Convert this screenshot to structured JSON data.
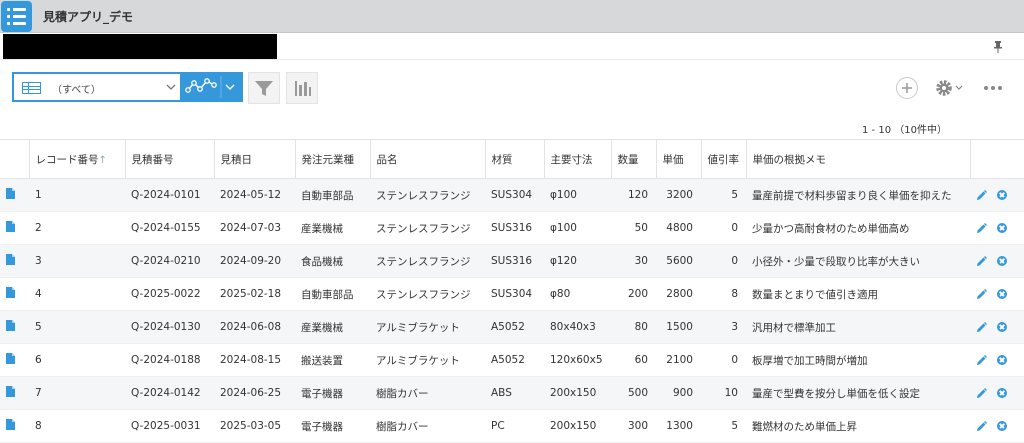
{
  "app": {
    "title": "見積アプリ_デモ"
  },
  "toolbar": {
    "view_label": "（すべて）",
    "pager_text": "1 - 10 （10件中）"
  },
  "table": {
    "columns": [
      "レコード番号",
      "見積番号",
      "見積日",
      "発注元業種",
      "品名",
      "材質",
      "主要寸法",
      "数量",
      "単価",
      "値引率",
      "単価の根拠メモ"
    ],
    "sort_indicator": "↑",
    "rows": [
      [
        "1",
        "Q-2024-0101",
        "2024-05-12",
        "自動車部品",
        "ステンレスフランジ",
        "SUS304",
        "φ100",
        "120",
        "3200",
        "5",
        "量産前提で材料歩留まり良く単価を抑えた"
      ],
      [
        "2",
        "Q-2024-0155",
        "2024-07-03",
        "産業機械",
        "ステンレスフランジ",
        "SUS316",
        "φ100",
        "50",
        "4800",
        "0",
        "少量かつ高耐食材のため単価高め"
      ],
      [
        "3",
        "Q-2024-0210",
        "2024-09-20",
        "食品機械",
        "ステンレスフランジ",
        "SUS316",
        "φ120",
        "30",
        "5600",
        "0",
        "小径外・少量で段取り比率が大きい"
      ],
      [
        "4",
        "Q-2025-0022",
        "2025-02-18",
        "自動車部品",
        "ステンレスフランジ",
        "SUS304",
        "φ80",
        "200",
        "2800",
        "8",
        "数量まとまりで値引き適用"
      ],
      [
        "5",
        "Q-2024-0130",
        "2024-06-08",
        "産業機械",
        "アルミブラケット",
        "A5052",
        "80x40x3",
        "80",
        "1500",
        "3",
        "汎用材で標準加工"
      ],
      [
        "6",
        "Q-2024-0188",
        "2024-08-15",
        "搬送装置",
        "アルミブラケット",
        "A5052",
        "120x60x5",
        "60",
        "2100",
        "0",
        "板厚増で加工時間が増加"
      ],
      [
        "7",
        "Q-2024-0142",
        "2024-06-25",
        "電子機器",
        "樹脂カバー",
        "ABS",
        "200x150",
        "500",
        "900",
        "10",
        "量産で型費を按分し単価を低く設定"
      ],
      [
        "8",
        "Q-2025-0031",
        "2025-03-05",
        "電子機器",
        "樹脂カバー",
        "PC",
        "200x150",
        "300",
        "1300",
        "5",
        "難燃材のため単価上昇"
      ]
    ]
  },
  "colors": {
    "accent": "#3498db",
    "header_bg": "#d6d8da",
    "row_alt": "#f5f6f7"
  },
  "icons": [
    "app-list-icon",
    "pin-icon",
    "table-icon",
    "chevron-down-icon",
    "graph-icon",
    "filter-icon",
    "bar-chart-icon",
    "plus-icon",
    "gear-icon",
    "more-icon",
    "document-icon",
    "edit-icon",
    "delete-icon"
  ]
}
